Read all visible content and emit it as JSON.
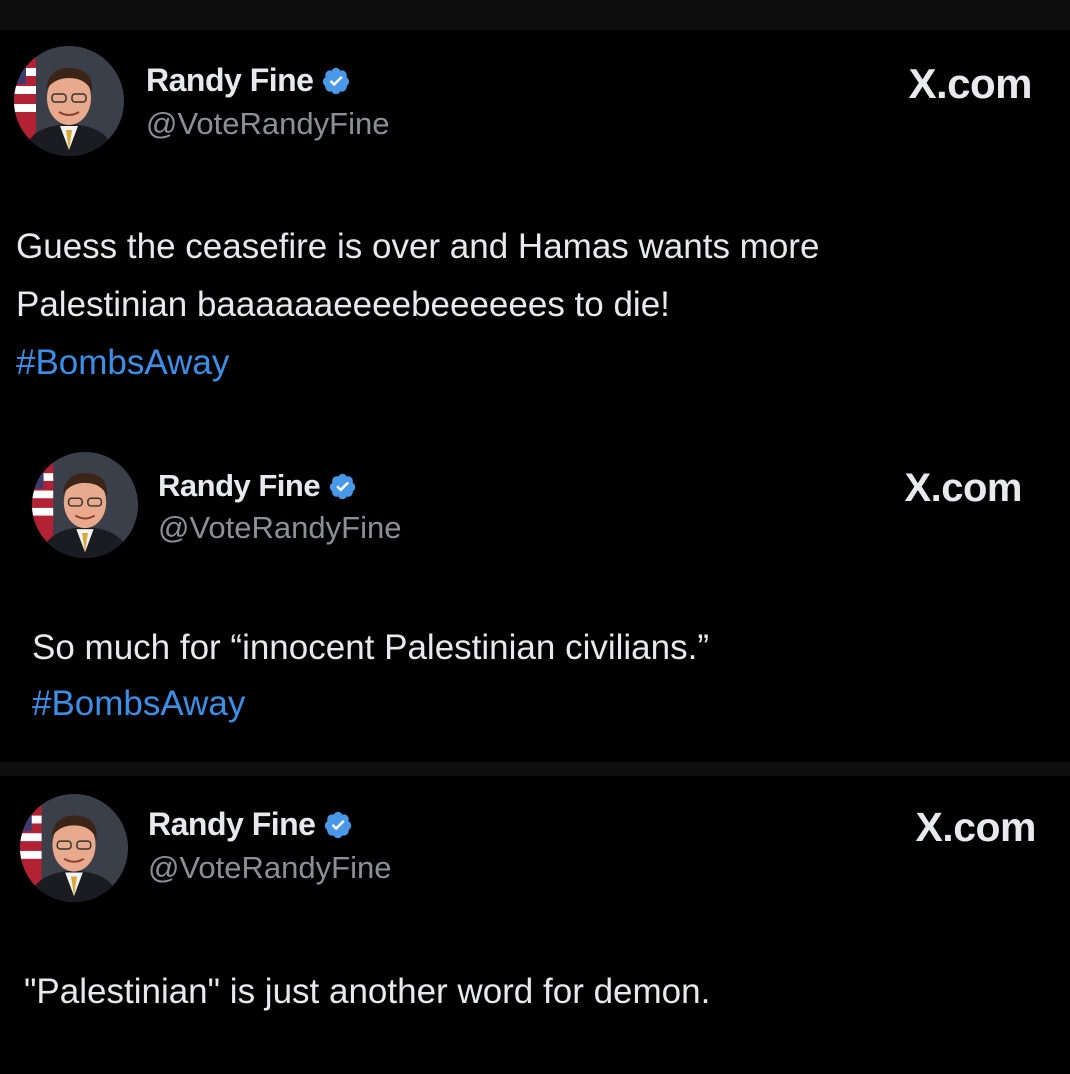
{
  "colors": {
    "background": "#000000",
    "text": "#e7e9ea",
    "handle": "#8b9096",
    "hashtag": "#3b8fe8",
    "verified_badge": "#4a99e9"
  },
  "tweets": [
    {
      "author_name": "Randy Fine",
      "verified_icon": "verified-badge-icon",
      "handle": "@VoteRandyFine",
      "source_label": "X.com",
      "text_lines": [
        "Guess the ceasefire is over and Hamas wants more",
        "Palestinian baaaaaaeeeebeeeeees to die!"
      ],
      "hashtag": "#BombsAway"
    },
    {
      "author_name": "Randy Fine",
      "verified_icon": "verified-badge-icon",
      "handle": "@VoteRandyFine",
      "source_label": "X.com",
      "text_lines": [
        "So much for “innocent Palestinian civilians.”"
      ],
      "hashtag": "#BombsAway"
    },
    {
      "author_name": "Randy Fine",
      "verified_icon": "verified-badge-icon",
      "handle": "@VoteRandyFine",
      "source_label": "X.com",
      "text_lines": [
        "\"Palestinian\" is just another word for demon."
      ]
    }
  ]
}
